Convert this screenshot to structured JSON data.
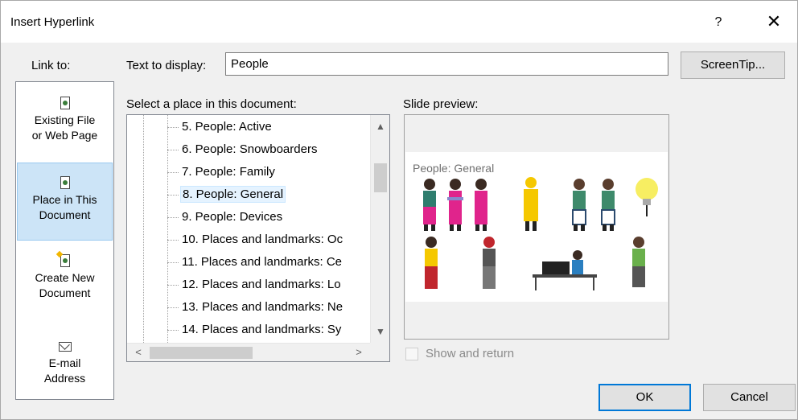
{
  "window": {
    "title": "Insert Hyperlink",
    "help": "?",
    "close_icon": "close-icon"
  },
  "link_to": {
    "label": "Link to:",
    "items": [
      {
        "line1": "Existing File",
        "line2": "or Web Page",
        "icon": "web-page-icon",
        "selected": false
      },
      {
        "line1": "Place in This",
        "line2": "Document",
        "icon": "place-in-document-icon",
        "selected": true
      },
      {
        "line1": "Create New",
        "line2": "Document",
        "icon": "new-document-icon",
        "selected": false
      },
      {
        "line1": "E-mail",
        "line2": "Address",
        "icon": "email-icon",
        "selected": false
      }
    ]
  },
  "text_to_display": {
    "label": "Text to display:",
    "value": "People"
  },
  "screentip_button": "ScreenTip...",
  "place_tree": {
    "label": "Select a place in this document:",
    "items": [
      "5. People: Active",
      "6. People: Snowboarders",
      "7. People: Family",
      "8. People: General",
      "9. People: Devices",
      "10. Places and landmarks: Oc",
      "11. Places and landmarks: Ce",
      "12. Places and landmarks: Lo",
      "13. Places and landmarks: Ne",
      "14. Places and landmarks: Sy"
    ],
    "selected_index": 3
  },
  "slide_preview": {
    "label": "Slide preview:",
    "slide_title": "People: General"
  },
  "show_and_return": {
    "label": "Show and return",
    "checked": false,
    "enabled": false
  },
  "buttons": {
    "ok": "OK",
    "cancel": "Cancel"
  },
  "colors": {
    "selection": "#cce4f7",
    "accent": "#0078d7",
    "magenta": "#e0248c",
    "yellow": "#f5c800"
  }
}
